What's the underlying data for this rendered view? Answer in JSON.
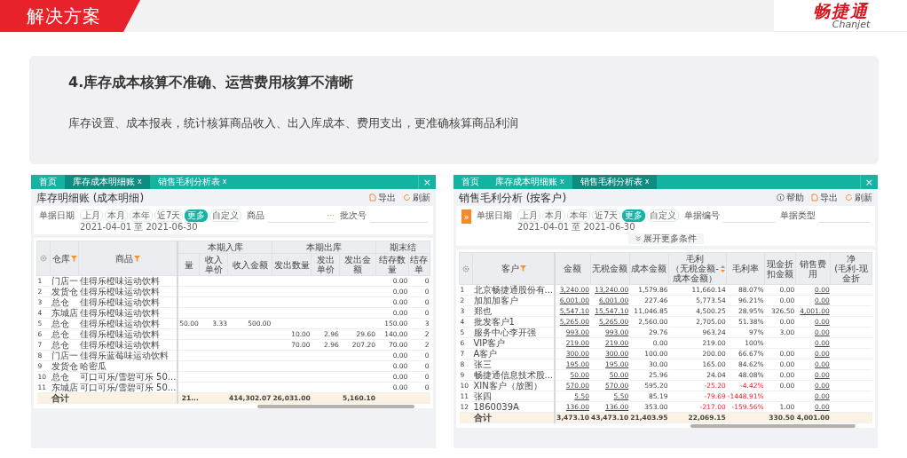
{
  "header": {
    "title": "解决方案",
    "logo_text": "畅捷通",
    "logo_subtext": "Chanjet"
  },
  "card": {
    "title": "4.库存成本核算不准确、运营费用核算不清晰",
    "description": "库存设置、成本报表，统计核算商品收入、出入库成本、费用支出，更准确核算商品利润"
  },
  "screens": [
    {
      "tabs": [
        {
          "label": "首页",
          "selected": false
        },
        {
          "label": "库存成本明细账",
          "close": "x",
          "selected": true
        },
        {
          "label": "销售毛利分析表",
          "close": "x",
          "selected": false
        }
      ],
      "close": "×",
      "page_title": "库存明细账 (成本明细)",
      "actions": [
        {
          "kind": "export",
          "label": "导出"
        },
        {
          "kind": "refresh",
          "label": "刷新"
        }
      ],
      "filter": {
        "date_label": "单据日期",
        "presets": [
          {
            "label": "上月",
            "selected": false
          },
          {
            "label": "本月",
            "selected": false
          },
          {
            "label": "本年",
            "selected": false
          },
          {
            "label": "近7天",
            "selected": false
          },
          {
            "label": "更多",
            "selected": true
          },
          {
            "label": "自定义",
            "selected": false
          }
        ],
        "date_range": "2021-04-01 至 2021-06-30",
        "fields": [
          {
            "label": "商品",
            "browse": "···"
          },
          {
            "label": "批次号"
          }
        ]
      },
      "table": {
        "columns": [
          {
            "kind": "settings"
          },
          {
            "kind": "filter",
            "label": "仓库"
          },
          {
            "kind": "filter",
            "label": "商品"
          },
          {
            "kind": "group",
            "label": "本期入库",
            "colspan": 3,
            "columns": [
              {
                "kind": "plain",
                "label": "量"
              },
              {
                "kind": "plain",
                "label": "收入单价"
              },
              {
                "kind": "plain",
                "label": "收入金额"
              }
            ]
          },
          {
            "kind": "group",
            "label": "本期出库",
            "colspan": 3,
            "columns": [
              {
                "kind": "plain",
                "label": "发出数量"
              },
              {
                "kind": "plain",
                "label": "发出单价"
              },
              {
                "kind": "plain",
                "label": "发出金额"
              }
            ]
          },
          {
            "kind": "group",
            "label": "期末结",
            "colspan": 2,
            "columns": [
              {
                "kind": "plain",
                "label": "结存数量"
              },
              {
                "kind": "plain",
                "label": "结存单"
              }
            ]
          }
        ],
        "rows": [
          {
            "kind": "data",
            "cells": [
              "1",
              "门店一",
              "佳得乐橙味运动饮料",
              null,
              null,
              null,
              null,
              null,
              null,
              "0.00",
              "0"
            ]
          },
          {
            "kind": "data",
            "cells": [
              "2",
              "发货仓",
              "佳得乐橙味运动饮料",
              null,
              null,
              null,
              null,
              null,
              null,
              "0.00",
              "0"
            ]
          },
          {
            "kind": "data",
            "cells": [
              "3",
              "总仓",
              "佳得乐橙味运动饮料",
              null,
              null,
              null,
              null,
              null,
              null,
              "0.00",
              "0"
            ]
          },
          {
            "kind": "data",
            "cells": [
              "4",
              "东城店",
              "佳得乐橙味运动饮料",
              null,
              null,
              null,
              null,
              null,
              null,
              "0.00",
              "0"
            ]
          },
          {
            "kind": "data",
            "cells": [
              "5",
              "总仓",
              "佳得乐橙味运动饮料",
              "50.00",
              "3.33",
              "500.00",
              null,
              null,
              null,
              "150.00",
              "3"
            ]
          },
          {
            "kind": "data",
            "cells": [
              "6",
              "总仓",
              "佳得乐橙味运动饮料",
              null,
              null,
              null,
              "10.00",
              "2.96",
              "29.60",
              "140.00",
              "2"
            ]
          },
          {
            "kind": "data",
            "cells": [
              "7",
              "总仓",
              "佳得乐橙味运动饮料",
              null,
              null,
              null,
              "70.00",
              "2.96",
              "207.20",
              "70.00",
              "2"
            ]
          },
          {
            "kind": "data",
            "cells": [
              "8",
              "门店一",
              "佳得乐蓝莓味运动饮料",
              null,
              null,
              null,
              null,
              null,
              null,
              "0.00",
              "0"
            ]
          },
          {
            "kind": "data",
            "cells": [
              "9",
              "发货仓",
              "哈密瓜",
              null,
              null,
              null,
              null,
              null,
              null,
              "0.00",
              "0"
            ]
          },
          {
            "kind": "data",
            "cells": [
              "10",
              "总仓",
              "可口可乐/雪碧可乐 50...",
              null,
              null,
              null,
              null,
              null,
              null,
              "0.00",
              "0"
            ]
          },
          {
            "kind": "data",
            "cells": [
              "11",
              "东城店",
              "可口可乐/雪碧可乐 50...",
              null,
              null,
              null,
              null,
              null,
              null,
              "0.00",
              "0"
            ]
          },
          {
            "kind": "total",
            "cells": [
              null,
              "合计",
              null,
              "21...",
              null,
              "414,302.07",
              "26,031.00",
              null,
              "5,160.10",
              null,
              null
            ]
          }
        ]
      }
    },
    {
      "tabs": [
        {
          "label": "首页",
          "selected": false
        },
        {
          "label": "库存成本明细账",
          "close": "x",
          "selected": false
        },
        {
          "label": "销售毛利分析表",
          "close": "x",
          "selected": true
        }
      ],
      "close": "×",
      "page_title": "销售毛利分析 (按客户)",
      "actions": [
        {
          "kind": "help",
          "label": "帮助"
        },
        {
          "kind": "export",
          "label": "导出"
        },
        {
          "kind": "refresh",
          "label": "刷新"
        }
      ],
      "filter": {
        "expand": "»",
        "date_label": "单据日期",
        "presets": [
          {
            "label": "上月",
            "selected": false
          },
          {
            "label": "本月",
            "selected": false
          },
          {
            "label": "本年",
            "selected": false
          },
          {
            "label": "近7天",
            "selected": false
          },
          {
            "label": "更多",
            "selected": true
          },
          {
            "label": "自定义",
            "selected": false
          }
        ],
        "date_range": "2021-04-01 至 2021-06-30",
        "fields": [
          {
            "label": "单据编号"
          },
          {
            "label": "单据类型"
          }
        ],
        "more_button": "展开更多条件"
      },
      "table": {
        "columns": [
          {
            "kind": "settings"
          },
          {
            "kind": "filter",
            "label": "客户"
          },
          {
            "kind": "link",
            "label": "金额"
          },
          {
            "kind": "link",
            "label": "无税金额"
          },
          {
            "kind": "plain",
            "label": "成本金额"
          },
          {
            "kind": "sort",
            "label": "毛利",
            "sub": "（无税金额-成本金额）"
          },
          {
            "kind": "profit",
            "label": "毛利率"
          },
          {
            "kind": "plain",
            "label": "现金折扣金额"
          },
          {
            "kind": "link",
            "label": "销售费用"
          },
          {
            "kind": "plain",
            "label": "净",
            "sub": "(毛利-现金折"
          }
        ],
        "rows": [
          {
            "kind": "data",
            "loss": false,
            "cells": [
              "1",
              "北京畅捷通股份有...",
              "3,240.00",
              "13,240.00",
              "1,579.86",
              "11,660.14",
              "88.07%",
              "0.00",
              "0.00",
              null
            ]
          },
          {
            "kind": "data",
            "loss": false,
            "cells": [
              "2",
              "加加加客户",
              "6,001.00",
              "6,001.00",
              "227.46",
              "5,773.54",
              "96.21%",
              "0.00",
              "0.00",
              null
            ]
          },
          {
            "kind": "data",
            "loss": false,
            "cells": [
              "3",
              "郑也",
              "5,547.10",
              "15,547.10",
              "11,046.85",
              "4,500.25",
              "28.95%",
              "326.50",
              "4,001.00",
              null
            ]
          },
          {
            "kind": "data",
            "loss": false,
            "cells": [
              "4",
              "批发客户1",
              "5,265.00",
              "5,265.00",
              "2,560.00",
              "2,705.00",
              "51.38%",
              "0.00",
              "0.00",
              null
            ]
          },
          {
            "kind": "data",
            "loss": false,
            "cells": [
              "5",
              "服务中心李开强",
              "993.00",
              "993.00",
              "29.76",
              "963.24",
              "97%",
              "3.00",
              "0.00",
              null
            ]
          },
          {
            "kind": "data",
            "loss": false,
            "cells": [
              "6",
              "VIP客户",
              "219.00",
              "219.00",
              "0.00",
              "219.00",
              "100%",
              null,
              "0.00",
              null
            ]
          },
          {
            "kind": "data",
            "loss": false,
            "cells": [
              "7",
              "A客户",
              "300.00",
              "300.00",
              "100.00",
              "200.00",
              "66.67%",
              "0.00",
              "0.00",
              null
            ]
          },
          {
            "kind": "data",
            "loss": false,
            "cells": [
              "8",
              "张三",
              "195.00",
              "195.00",
              "30.00",
              "165.00",
              "84.62%",
              "0.00",
              "0.00",
              null
            ]
          },
          {
            "kind": "data",
            "loss": false,
            "cells": [
              "9",
              "畅捷通信息技术股...",
              "50.00",
              "50.00",
              "25.96",
              "24.04",
              "48.08%",
              "0.00",
              "0.00",
              null
            ]
          },
          {
            "kind": "data",
            "loss": true,
            "cells": [
              "10",
              "XIN客户（放图）",
              "570.00",
              "570.00",
              "595.20",
              "-25.20",
              "-4.42%",
              "0.00",
              "0.00",
              null
            ]
          },
          {
            "kind": "data",
            "loss": true,
            "cells": [
              "11",
              "张四",
              "5.50",
              "5.50",
              "85.19",
              "-79.69",
              "-1448.91%",
              null,
              "0.00",
              null
            ]
          },
          {
            "kind": "data",
            "loss": true,
            "cells": [
              "12",
              "1860039A",
              "136.00",
              "136.00",
              "353.00",
              "-217.00",
              "-159.56%",
              "1.00",
              "0.00",
              null
            ]
          },
          {
            "kind": "total",
            "cells": [
              null,
              "合计",
              "3,473.10",
              "43,473.10",
              "21,403.95",
              "22,069.15",
              null,
              "330.50",
              "4,001.00",
              null
            ]
          }
        ]
      }
    }
  ]
}
